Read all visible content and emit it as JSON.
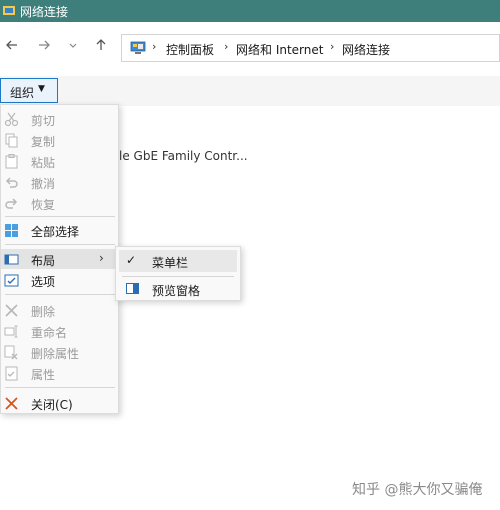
{
  "window": {
    "title": "网络连接"
  },
  "nav": {
    "back_icon": "arrow-left-icon",
    "forward_icon": "arrow-right-icon",
    "recent_icon": "chevron-down-icon",
    "up_icon": "arrow-up-icon"
  },
  "address": {
    "crumbs": [
      "控制面板",
      "网络和 Internet",
      "网络连接"
    ]
  },
  "toolbar": {
    "organize_label": "组织"
  },
  "content": {
    "partial_text": "le GbE Family Contr..."
  },
  "menu": {
    "items": [
      {
        "label": "剪切",
        "icon": "scissors-icon",
        "enabled": false
      },
      {
        "label": "复制",
        "icon": "copy-icon",
        "enabled": false
      },
      {
        "label": "粘贴",
        "icon": "paste-icon",
        "enabled": false
      },
      {
        "label": "撤消",
        "icon": "undo-icon",
        "enabled": false
      },
      {
        "label": "恢复",
        "icon": "redo-icon",
        "enabled": false
      },
      {
        "label": "全部选择",
        "icon": "select-all-icon",
        "enabled": true
      },
      {
        "label": "布局",
        "icon": "layout-icon",
        "enabled": true,
        "has_submenu": true
      },
      {
        "label": "选项",
        "icon": "options-icon",
        "enabled": true
      },
      {
        "label": "删除",
        "icon": "delete-icon",
        "enabled": false
      },
      {
        "label": "重命名",
        "icon": "rename-icon",
        "enabled": false
      },
      {
        "label": "删除属性",
        "icon": "remove-properties-icon",
        "enabled": false
      },
      {
        "label": "属性",
        "icon": "properties-icon",
        "enabled": false
      },
      {
        "label": "关闭(C)",
        "icon": "close-icon",
        "enabled": true
      }
    ]
  },
  "submenu": {
    "items": [
      {
        "label": "菜单栏",
        "checked": true
      },
      {
        "label": "预览窗格",
        "icon": "preview-pane-icon"
      }
    ]
  },
  "watermark": "知乎 @熊大你又骗俺",
  "colors": {
    "titlebar": "#3e7f7c",
    "accent": "#1e78c8",
    "close_x": "#d9531e"
  }
}
